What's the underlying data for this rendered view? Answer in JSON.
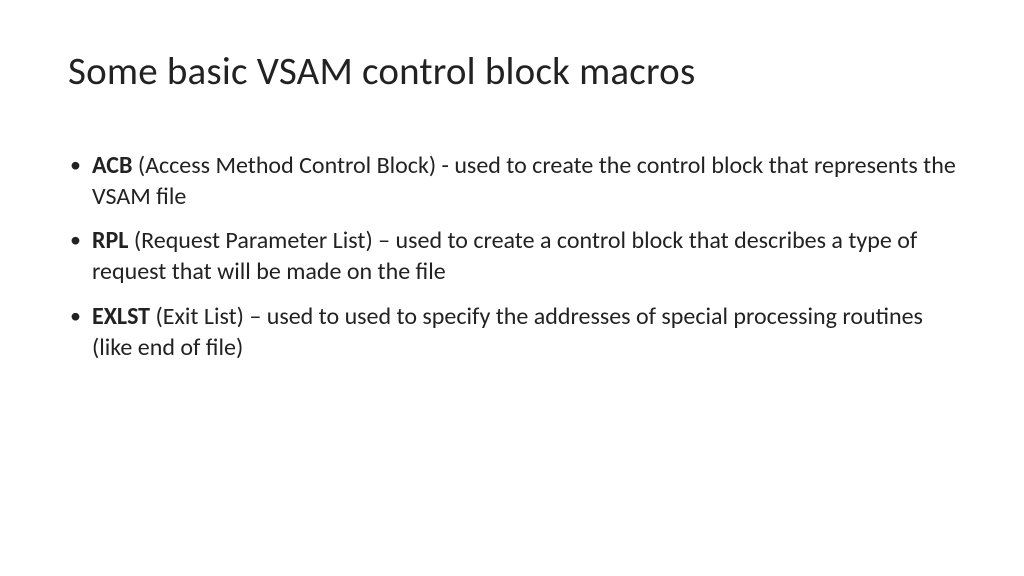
{
  "title": "Some basic VSAM control block macros",
  "bullets": [
    {
      "bold": "ACB",
      "rest": " (Access Method Control Block) - used to create the control block that represents the VSAM file"
    },
    {
      "bold": "RPL",
      "rest": " (Request Parameter List) – used to create a control block that describes a type of request that will be made on the file"
    },
    {
      "bold": "EXLST",
      "rest": " (Exit List) – used to used to specify the addresses of special processing routines (like end of file)"
    }
  ]
}
